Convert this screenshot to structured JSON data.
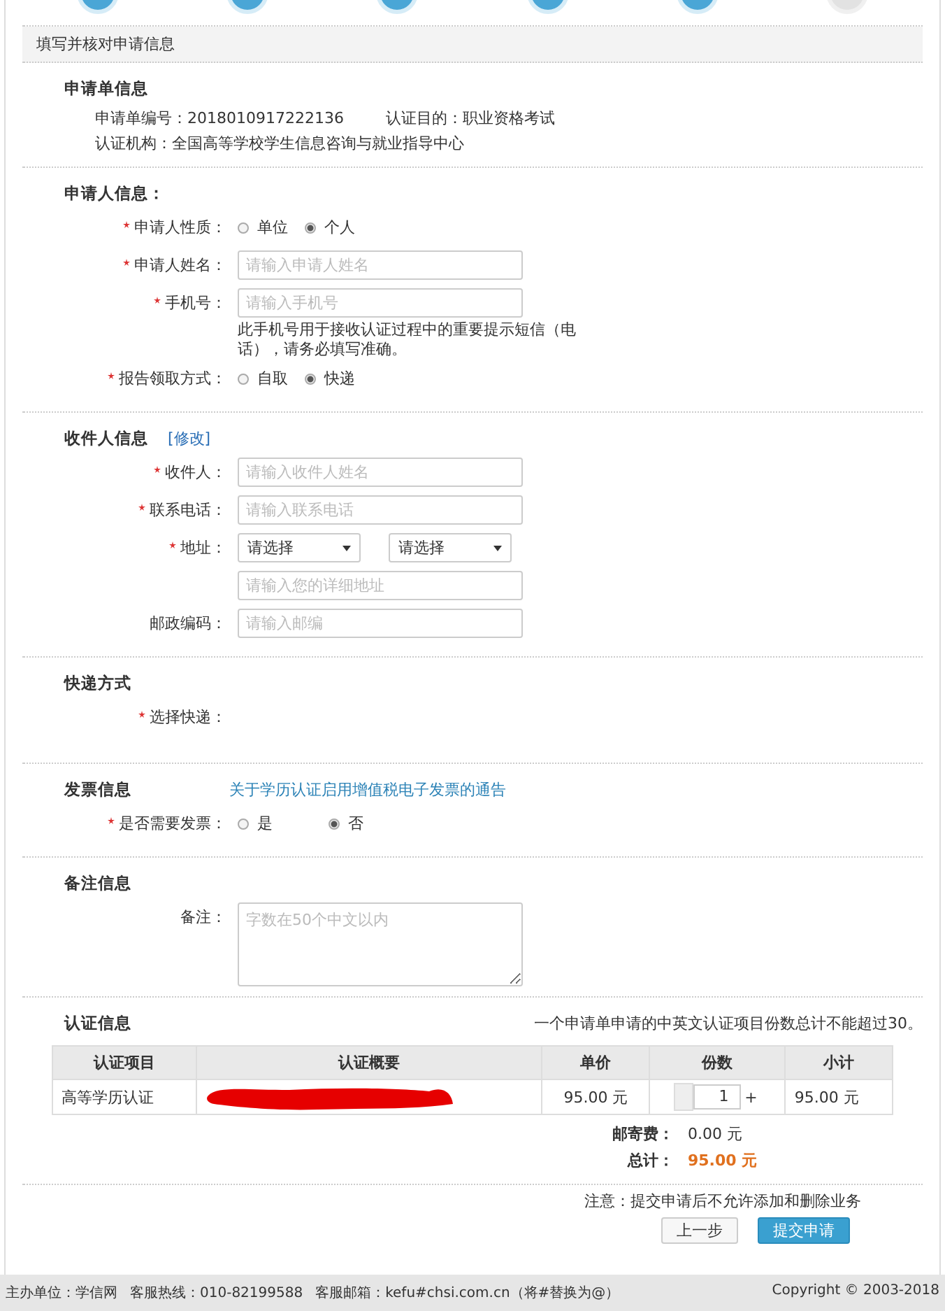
{
  "steps": [
    {
      "done": true
    },
    {
      "done": true
    },
    {
      "done": true
    },
    {
      "done": true
    },
    {
      "done": true
    },
    {
      "done": false
    }
  ],
  "section_title": "填写并核对申请信息",
  "application": {
    "heading": "申请单信息",
    "lines": [
      {
        "texts": [
          "申请单编号：2018010917222136",
          "认证目的：职业资格考试"
        ]
      },
      {
        "texts": [
          "认证机构：全国高等学校学生信息咨询与就业指导中心"
        ]
      }
    ]
  },
  "applicant": {
    "heading": "申请人信息：",
    "fields": [
      {
        "kind": "radio",
        "label": "申请人性质：",
        "required": true,
        "options": [
          {
            "label": "单位",
            "selected": false
          },
          {
            "label": "个人",
            "selected": true
          }
        ]
      },
      {
        "kind": "input",
        "label": "申请人姓名：",
        "required": true,
        "placeholder": "请输入申请人姓名"
      },
      {
        "kind": "input",
        "label": "手机号：",
        "required": true,
        "placeholder": "请输入手机号",
        "note": "此手机号用于接收认证过程中的重要提示短信（电话），请务必填写准确。"
      },
      {
        "kind": "radio",
        "label": "报告领取方式：",
        "required": true,
        "options": [
          {
            "label": "自取",
            "selected": false
          },
          {
            "label": "快递",
            "selected": true
          }
        ]
      }
    ]
  },
  "recipient": {
    "heading": "收件人信息",
    "edit_link": "[修改]",
    "fields": [
      {
        "kind": "input",
        "label": "收件人：",
        "required": true,
        "placeholder": "请输入收件人姓名"
      },
      {
        "kind": "input",
        "label": "联系电话：",
        "required": true,
        "placeholder": "请输入联系电话"
      },
      {
        "kind": "selects",
        "label": "地址：",
        "required": true,
        "options": [
          "请选择",
          "请选择"
        ]
      },
      {
        "kind": "input",
        "placeholder": "请输入您的详细地址"
      },
      {
        "kind": "input",
        "label": "邮政编码：",
        "required": false,
        "placeholder": "请输入邮编"
      }
    ]
  },
  "delivery": {
    "heading": "快递方式",
    "fields": [
      {
        "label": "选择快递：",
        "required": true
      }
    ]
  },
  "invoice": {
    "heading": "发票信息",
    "notice_link": "关于学历认证启用增值税电子发票的通告",
    "fields": [
      {
        "kind": "radio",
        "label": "是否需要发票：",
        "required": true,
        "options": [
          {
            "label": "是",
            "selected": false
          },
          {
            "label": "否",
            "selected": true
          }
        ]
      }
    ]
  },
  "remarks": {
    "heading": "备注信息",
    "fields": [
      {
        "kind": "textarea",
        "label": "备注：",
        "required": false,
        "placeholder": "字数在50个中文以内"
      }
    ]
  },
  "certification": {
    "heading": "认证信息",
    "hint": "一个申请单申请的中英文认证项目份数总计不能超过30。",
    "table": {
      "columns": [
        "认证项目",
        "认证概要",
        "单价",
        "份数",
        "小计"
      ],
      "rows": [
        {
          "item": "高等学历认证",
          "summary_redacted": true,
          "unit_price": "95.00 元",
          "quantity": "1",
          "increment": "+",
          "subtotal": "95.00 元"
        }
      ]
    },
    "totals": [
      {
        "kind": "normal",
        "label": "邮寄费：",
        "value": "0.00 元"
      },
      {
        "kind": "total",
        "label": "总计：",
        "value": "95.00 元"
      }
    ]
  },
  "notice": "注意：提交申请后不允许添加和删除业务",
  "buttons": [
    {
      "kind": "secondary",
      "label": "上一步"
    },
    {
      "kind": "primary",
      "label": "提交申请"
    }
  ],
  "footer": [
    "主办单位：学信网",
    "客服热线：010-82199588",
    "客服邮箱：kefu#chsi.com.cn（将#替换为@）",
    "Copyright © 2003-2018"
  ]
}
